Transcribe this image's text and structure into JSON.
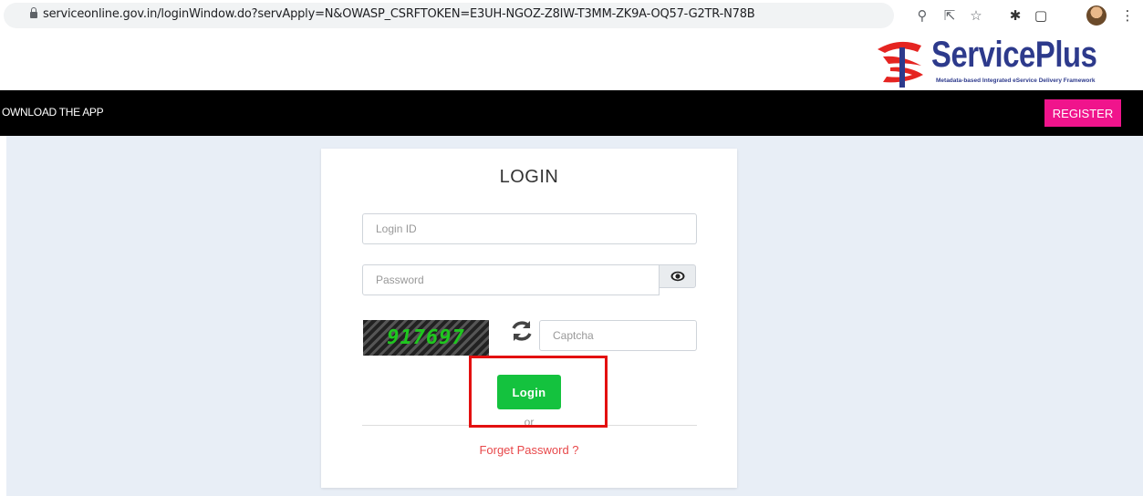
{
  "browser": {
    "url": "serviceonline.gov.in/loginWindow.do?servApply=N&OWASP_CSRFTOKEN=E3UH-NGOZ-Z8IW-T3MM-ZK9A-OQ57-G2TR-N78B",
    "icons": [
      "lock-icon",
      "zoom-icon",
      "share-icon",
      "star-icon",
      "extensions-icon",
      "sidepanel-icon",
      "profile-avatar",
      "menu-icon"
    ]
  },
  "header": {
    "brand": "ServicePlus",
    "tagline": "Metadata-based Integrated eService Delivery Framework"
  },
  "nav": {
    "download_label": "OWNLOAD THE APP",
    "register_label": "REGISTER"
  },
  "login": {
    "title": "LOGIN",
    "login_id_placeholder": "Login ID",
    "password_placeholder": "Password",
    "captcha_text": "917697",
    "captcha_placeholder": "Captcha",
    "login_button": "Login",
    "or_text": "or",
    "forgot_link": "Forget Password ?"
  },
  "colors": {
    "brand_blue": "#2d3a8c",
    "brand_red": "#e52421",
    "register_pink": "#f0148c",
    "login_green": "#14c23e",
    "highlight_red": "#e31010",
    "forgot_red": "#e8484a"
  }
}
